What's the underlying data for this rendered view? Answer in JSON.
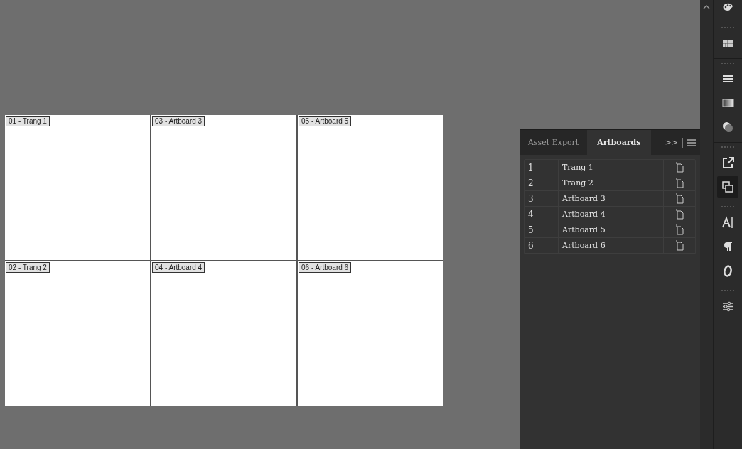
{
  "canvas": {
    "artboards": [
      {
        "label": "01 - Trang 1"
      },
      {
        "label": "03 - Artboard 3"
      },
      {
        "label": "05 - Artboard 5"
      },
      {
        "label": "02 - Trang 2"
      },
      {
        "label": "04 - Artboard 4"
      },
      {
        "label": "06 - Artboard 6"
      }
    ]
  },
  "panel": {
    "tabs": [
      {
        "label": "Asset Export",
        "selected": false
      },
      {
        "label": "Artboards",
        "selected": true
      }
    ],
    "overflow": ">>",
    "rows": [
      {
        "number": "1",
        "name": "Trang 1"
      },
      {
        "number": "2",
        "name": "Trang 2"
      },
      {
        "number": "3",
        "name": "Artboard 3"
      },
      {
        "number": "4",
        "name": "Artboard 4"
      },
      {
        "number": "5",
        "name": "Artboard 5"
      },
      {
        "number": "6",
        "name": "Artboard 6"
      }
    ]
  },
  "toolbar": [
    {
      "kind": "palette",
      "selected": false
    },
    {
      "kind": "swatches",
      "selected": false
    },
    {
      "kind": "stroke",
      "selected": false
    },
    {
      "kind": "gradient",
      "selected": false
    },
    {
      "kind": "transparency",
      "selected": false
    },
    {
      "kind": "export",
      "selected": false
    },
    {
      "kind": "artboards",
      "selected": true
    },
    {
      "kind": "character",
      "selected": false
    },
    {
      "kind": "paragraph",
      "selected": false
    },
    {
      "kind": "opentype",
      "selected": false
    },
    {
      "kind": "properties",
      "selected": false
    }
  ]
}
